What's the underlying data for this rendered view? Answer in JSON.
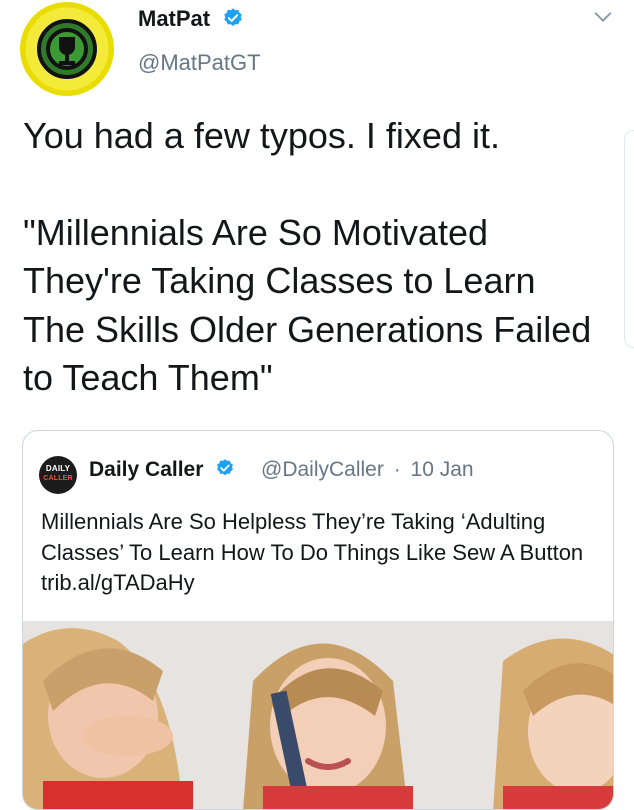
{
  "author": {
    "name": "MatPat",
    "handle": "@MatPatGT",
    "verified_color": "#1da1f2",
    "avatar_icon": "game-theory-logo"
  },
  "tweet": {
    "line1": "You had a few typos. I fixed it.",
    "quote_text": "\"Millennials Are So Motivated They're Taking Classes to Learn The Skills Older Generations Failed to Teach Them\""
  },
  "quoted_tweet": {
    "avatar_line1": "DAILY",
    "avatar_line2": "CALLER",
    "name": "Daily Caller",
    "handle": "@DailyCaller",
    "separator": "·",
    "date": "10 Jan",
    "text": "Millennials Are So Helpless They’re Taking ‘Adulting Classes’ To Learn How To Do Things Like Sew A Button trib.al/gTADaHy",
    "media_description_icon": "photo-three-women"
  },
  "icons": {
    "menu": "chevron-down-icon",
    "verified": "verified-badge-icon"
  }
}
